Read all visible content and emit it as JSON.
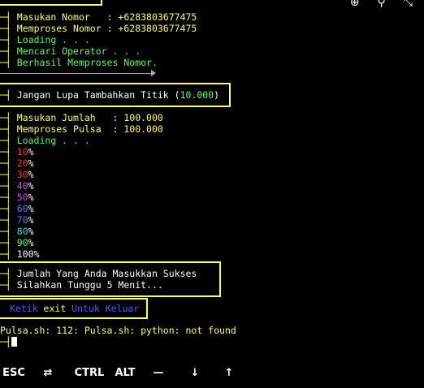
{
  "top_icons": [
    "zoom-in-icon",
    "search-icon",
    "collapse-icon"
  ],
  "arrow": "─┤",
  "block1": [
    {
      "label": "Masukan Nomor   : +6283803677475",
      "color": "#ffff55"
    },
    {
      "label": "Memproses Nomor : +6283803677475",
      "color": "#ffff55"
    },
    {
      "label": "Loading . . .",
      "color": "#55ff55"
    },
    {
      "label": "Mencari Operator . . .",
      "color": "#55ff55"
    },
    {
      "label": "Berhasil Memproses Nomor.",
      "color": "#55ff55"
    }
  ],
  "notice": {
    "text": "Jangan Lupa Tambahkan Titik (",
    "value": "10.000",
    "close": ")"
  },
  "block2": [
    {
      "label": "Masukan Jumlah   : 100.000",
      "color": "#ffff55"
    },
    {
      "label": "Memproses Pulsa  : 100.000",
      "color": "#ffff55"
    },
    {
      "label": "Loading . . .",
      "color": "#55ff55"
    }
  ],
  "progress": [
    {
      "num": "10",
      "color": "#ff3333"
    },
    {
      "num": "20",
      "color": "#ff3333"
    },
    {
      "num": "30",
      "color": "#ff3333"
    },
    {
      "num": "40",
      "color": "#dd44ee"
    },
    {
      "num": "50",
      "color": "#dd44ee"
    },
    {
      "num": "60",
      "color": "#6677ff"
    },
    {
      "num": "70",
      "color": "#6677ff"
    },
    {
      "num": "80",
      "color": "#33dddd"
    },
    {
      "num": "90",
      "color": "#55ff55"
    },
    {
      "num": "100",
      "color": "#ffffff"
    }
  ],
  "percent": "%",
  "success": {
    "line1": "Jumlah Yang Anda Masukkan Sukses",
    "line2": "Silahkan Tunggu 5 Menit..."
  },
  "exit": {
    "a": "Ketik ",
    "b": "exit",
    "c": " Untuk ",
    "d": "Keluar"
  },
  "error": "Pulsa.sh: 112: Pulsa.sh: python: not found",
  "keys": [
    "ESC",
    "⇄",
    "CTRL",
    "ALT",
    "—",
    "↓",
    "↑"
  ]
}
